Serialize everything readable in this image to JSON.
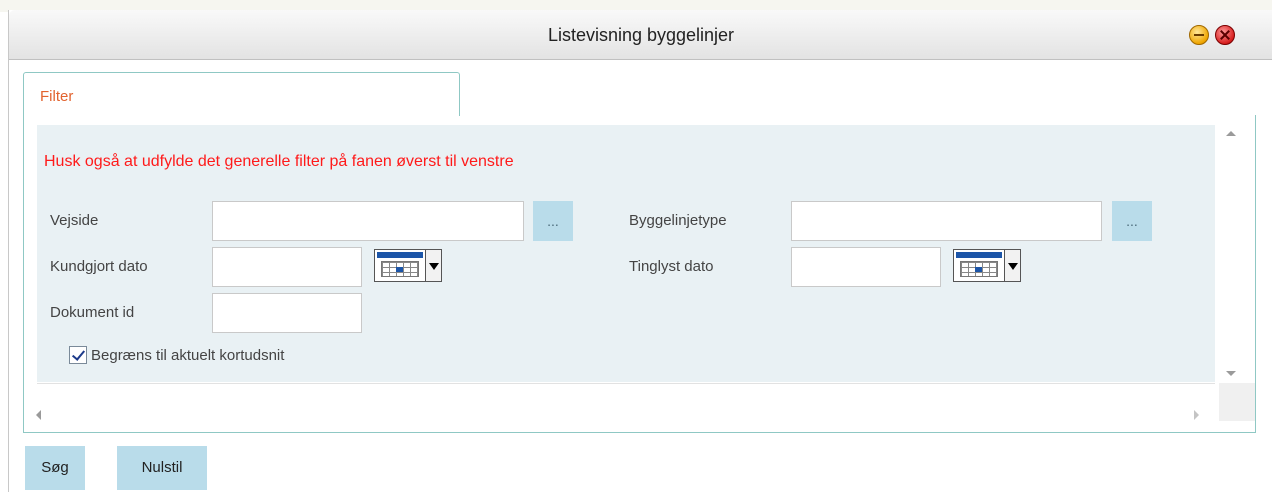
{
  "window": {
    "title": "Listevisning byggelinjer"
  },
  "tabs": [
    {
      "label": "Filter",
      "active": true
    }
  ],
  "filter": {
    "warning": "Husk også at udfylde det generelle filter på fanen øverst til venstre",
    "vejside": {
      "label": "Vejside",
      "value": "",
      "lookup_label": "..."
    },
    "byggelinjetype": {
      "label": "Byggelinjetype",
      "value": "",
      "lookup_label": "..."
    },
    "kundgjort_dato": {
      "label": "Kundgjort dato",
      "value": ""
    },
    "tinglyst_dato": {
      "label": "Tinglyst dato",
      "value": ""
    },
    "dokument_id": {
      "label": "Dokument id",
      "value": ""
    },
    "begraens": {
      "label": "Begræns til aktuelt kortudsnit",
      "checked": true
    }
  },
  "actions": {
    "search_label": "Søg",
    "reset_label": "Nulstil"
  },
  "icons": [
    "minimize-icon",
    "close-icon",
    "calendar-icon",
    "scroll-up-icon",
    "scroll-down-icon",
    "scroll-left-icon",
    "scroll-right-icon",
    "checkmark-icon"
  ],
  "colors": {
    "accent_tab": "#e2632f",
    "warning": "#ff1a1a",
    "button_bg": "#b9dcea",
    "panel_bg": "#e9f1f4",
    "border": "#8fc8c4"
  }
}
